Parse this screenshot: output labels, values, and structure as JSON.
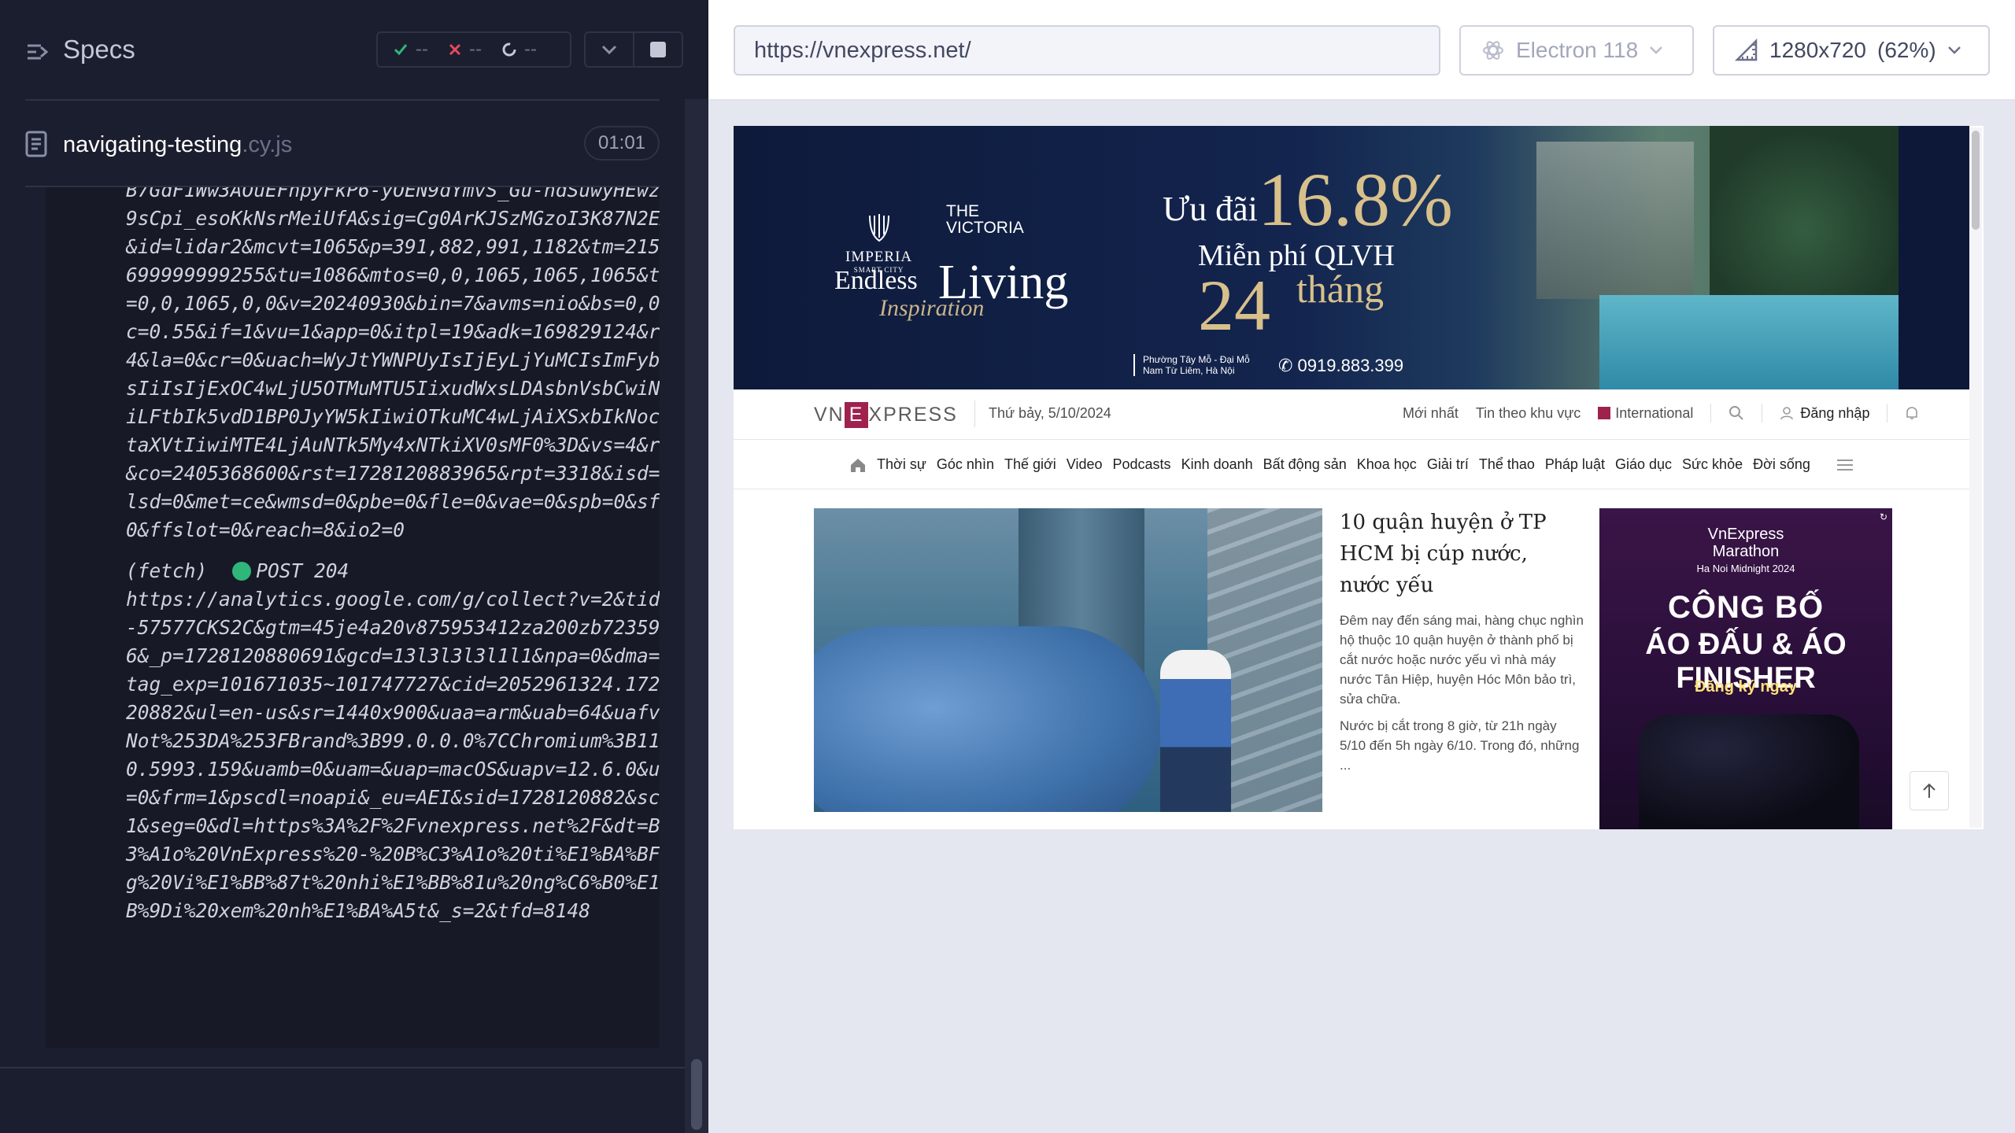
{
  "reporter": {
    "title": "Specs",
    "stats": {
      "passed": "--",
      "failed": "--",
      "pending": "--"
    },
    "file": {
      "name": "navigating-testing",
      "ext": ".cy.js",
      "duration": "01:01"
    },
    "log_prev": "B7GdF1Ww3AOuEFhpyFkP6-yOEN9dYmvS_Gu-hdSuwyHEwzCH9sCpi_esoKkNsrMeiUfA&sig=Cg0ArKJSzMGzoI3K87N2EAE&id=lidar2&mcvt=1065&p=391,882,991,1182&tm=2150.699999999255&tu=1086&mtos=0,0,1065,1065,1065&tos=0,0,1065,0,0&v=20240930&bin=7&avms=nio&bs=0,0&mc=0.55&if=1&vu=1&app=0&itpl=19&adk=169829124&rs=4&la=0&cr=0&uach=WyJtYWNPUyIsIjEyLjYuMCIsImFybSIsIiIsIjExOC4wLjU5OTMuMTU5IixudWxsLDAsbnVsbCwiNjQiLFtbIk5vdD1BP0JyYW5kIiwiOTkuMC4wLjAiXSxbIkNocm9taXVtIiwiMTE4LjAuNTk5My4xNTkiXV0sMF0%3D&vs=4&r=v&co=2405368600&rst=1728120883965&rpt=3318&isd=0&lsd=0&met=ce&wmsd=0&pbe=0&fle=0&vae=0&spb=0&sfl=0&ffslot=0&reach=8&io2=0",
    "fetch_label": "(fetch)",
    "fetch_method": "POST 204",
    "fetch_url": "https://analytics.google.com/g/collect?v=2&tid=G-57577CKS2C&gtm=45je4a20v875953412za200zb72359946&_p=1728120880691&gcd=13l3l3l3l1l1&npa=0&dma=0&tag_exp=101671035~101747727&cid=2052961324.1728120882&ul=en-us&sr=1440x900&uaa=arm&uab=64&uafvl=Not%253DA%253FBrand%3B99.0.0.0%7CChromium%3B118.0.5993.159&uamb=0&uam=&uap=macOS&uapv=12.6.0&uaw=0&frm=1&pscdl=noapi&_eu=AEI&sid=1728120882&sct=1&seg=0&dl=https%3A%2F%2Fvnexpress.net%2F&dt=B%C3%A1o%20VnExpress%20-%20B%C3%A1o%20ti%E1%BA%BFng%20Vi%E1%BB%87t%20nhi%E1%BB%81u%20ng%C6%B0%E1%BB%9Di%20xem%20nh%E1%BA%A5t&_s=2&tfd=8148"
  },
  "browser": {
    "url": "https://vnexpress.net/",
    "engine": "Electron 118",
    "viewport": "1280x720",
    "zoom": "(62%)"
  },
  "banner": {
    "brand1": "IMPERIA",
    "brand1_sub": "SMART CITY",
    "brand2_line1": "THE",
    "brand2_line2": "VICTORIA",
    "endless": "Endless",
    "living": "Living",
    "inspiration": "Inspiration",
    "uudai": "Ưu đãi",
    "percent": "16.8%",
    "mienphi": "Miễn phí QLVH",
    "months_num": "24",
    "months_word": "tháng",
    "address_line1": "Phường Tây Mỗ - Đại Mỗ",
    "address_line2": "Nam Từ Liêm, Hà Nội",
    "phone": "0919.883.399"
  },
  "vnexpress": {
    "logo_left": "VN",
    "logo_e": "E",
    "logo_right": "XPRESS",
    "date": "Thứ bảy, 5/10/2024",
    "top_links": [
      "Mới nhất",
      "Tin theo khu vực",
      "International"
    ],
    "login": "Đăng nhập",
    "nav": [
      "Thời sự",
      "Góc nhìn",
      "Thế giới",
      "Video",
      "Podcasts",
      "Kinh doanh",
      "Bất động sản",
      "Khoa học",
      "Giải trí",
      "Thể thao",
      "Pháp luật",
      "Giáo dục",
      "Sức khỏe",
      "Đời sống"
    ],
    "headline": "10 quận huyện ở TP HCM bị cúp nước, nước yếu",
    "desc1": "Đêm nay đến sáng mai, hàng chục nghìn hộ thuộc 10 quận huyện ở thành phố bị cắt nước hoặc nước yếu vì nhà máy nước Tân Hiệp, huyện Hóc Môn bảo trì, sửa chữa.",
    "desc2": "Nước bị cắt trong 8 giờ, từ 21h ngày 5/10 đến 5h ngày 6/10. Trong đó, những ..."
  },
  "ad": {
    "brand": "VnExpress",
    "brand2": "Marathon",
    "sub": "Ha Noi Midnight 2024",
    "line1": "CÔNG BỐ",
    "line2": "ÁO ĐẤU & ÁO FINISHER",
    "cta": "Đăng ký ngay"
  },
  "colors": {
    "reporter_bg": "#1b1e2e",
    "pass": "#2fb67a",
    "fail": "#e44a5b",
    "vne_brand": "#9f224e"
  }
}
